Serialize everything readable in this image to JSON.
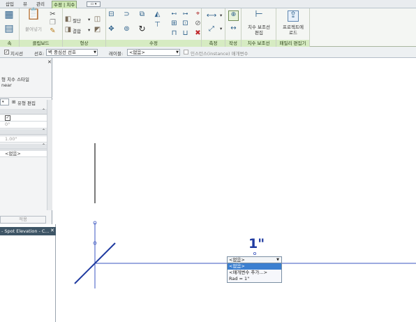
{
  "tabs": [
    "삽입",
    "뷰",
    "관리",
    "수정 | 치수"
  ],
  "ribbon": {
    "clipboard": {
      "paste_label": "붙여넣기",
      "panel_label": "클립보드"
    },
    "geometry": {
      "cut_label": "절단",
      "join_label": "결합",
      "panel_label": "형상"
    },
    "modify": {
      "panel_label": "수정"
    },
    "measure": {
      "panel_label": "측정"
    },
    "create": {
      "panel_label": "작성"
    },
    "witness": {
      "button_label_1": "치수 보조선",
      "button_label_2": "편집",
      "panel_label": "치수 보조선"
    },
    "family": {
      "button_label_1": "프로젝트에",
      "button_label_2": "로드",
      "panel_label": "패밀리 편집기"
    }
  },
  "options_bar": {
    "leader_label": "지시선",
    "prefer_label": "선호:",
    "prefer_value": "벽 중심선 선호",
    "label_label": "레이블:",
    "label_value": "<없음>",
    "instance_param_label": "인스턴스(instance) 매개변수"
  },
  "properties": {
    "type_name_1": "형 치수 스타일",
    "type_name_2": "near",
    "edit_type_label": "유형 편집",
    "row_checked": "✓",
    "row_angle": "0°",
    "row_scale": "1.00\"",
    "row_label": "<없음>",
    "apply_label": "적용"
  },
  "project_browser": {
    "title": "- Spot Elevation - C..."
  },
  "canvas": {
    "dimension_text": "1\"",
    "dropdown_value": "<없음>",
    "dropdown_items": [
      "<없음>",
      "<매개변수 추가...>",
      "Rad = 1\""
    ]
  },
  "colors": {
    "ribbon_accent": "#d6ebc2",
    "geometry_blue": "#1f3aa0",
    "selection_blue": "#3b7fd0"
  }
}
